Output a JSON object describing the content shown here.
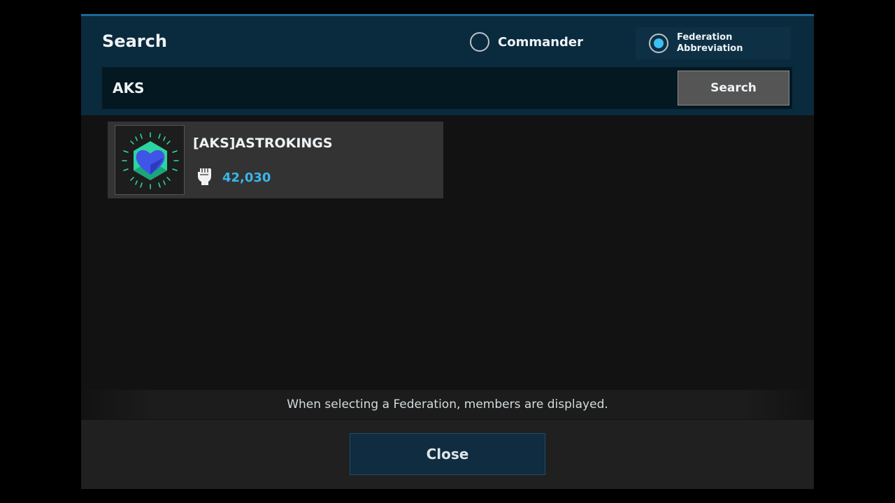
{
  "dialog": {
    "title": "Search",
    "search_type": {
      "options": [
        {
          "label": "Commander",
          "selected": false
        },
        {
          "label_line1": "Federation",
          "label_line2": "Abbreviation",
          "selected": true
        }
      ]
    },
    "search": {
      "value": "AKS",
      "button_label": "Search"
    },
    "results": [
      {
        "name": "[AKS]ASTROKINGS",
        "power": "42,030",
        "emblem_icon": "blue-heart-green-hexagon-emblem",
        "power_icon": "fist-icon"
      }
    ],
    "info_text": "When selecting a Federation, members are displayed.",
    "close_label": "Close"
  },
  "colors": {
    "accent": "#3ab6ea",
    "header_bg": "#0a2a3e",
    "button_primary_bg": "#0f2c40"
  }
}
